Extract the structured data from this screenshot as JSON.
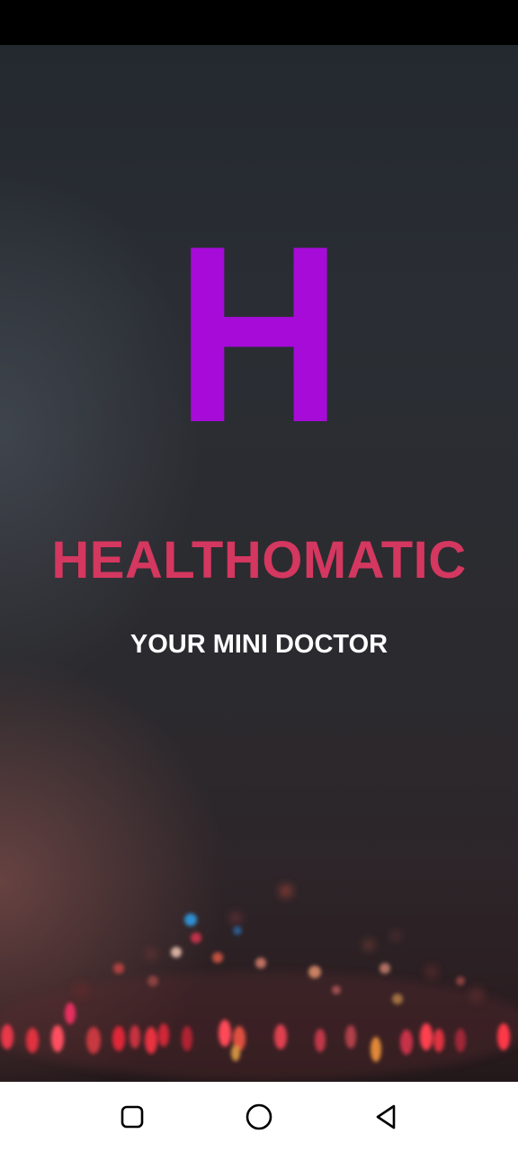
{
  "app": {
    "logo_letter": "H",
    "name": "HEALTHOMATIC",
    "tagline": "YOUR MINI DOCTOR"
  },
  "colors": {
    "logo": "#a60bd8",
    "app_name": "#d4375f",
    "tagline": "#ffffff",
    "nav_bar": "#ffffff",
    "status_bar": "#000000"
  },
  "system_nav": {
    "buttons": [
      {
        "icon": "recents-square-icon"
      },
      {
        "icon": "home-circle-icon"
      },
      {
        "icon": "back-triangle-icon"
      }
    ]
  }
}
